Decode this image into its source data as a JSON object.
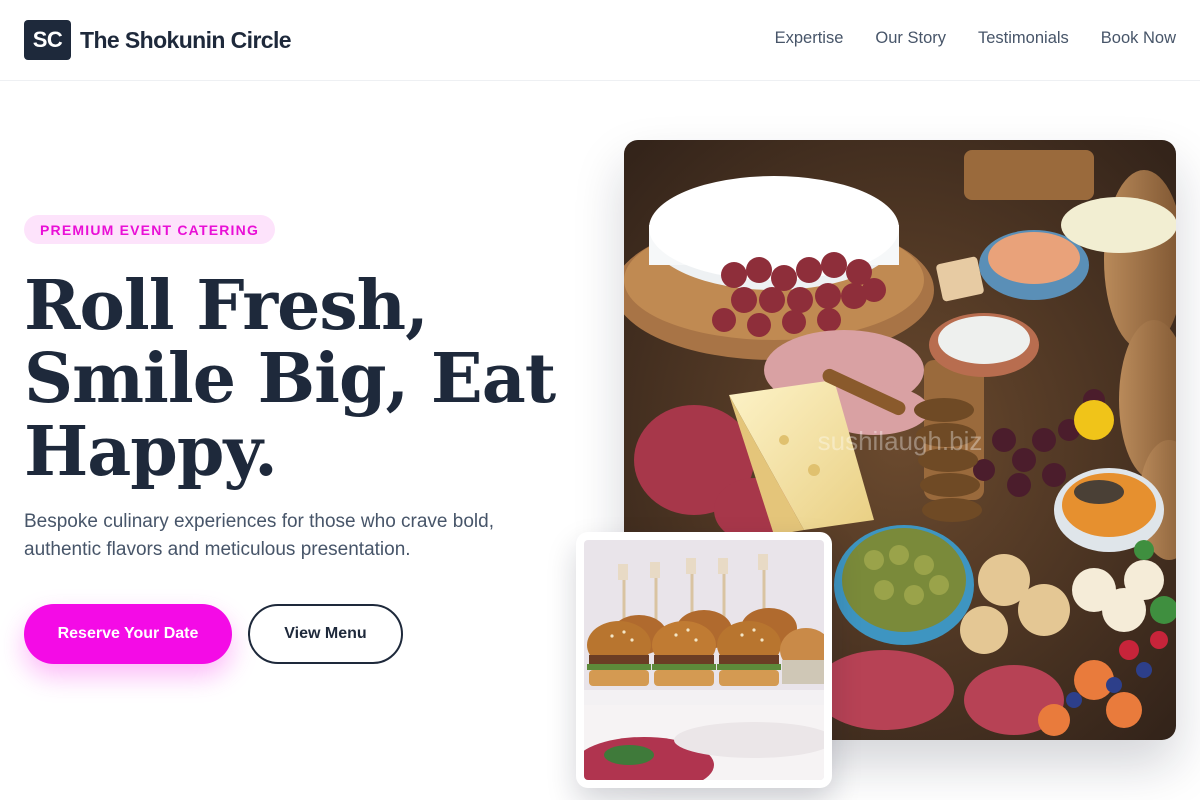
{
  "header": {
    "logo_mark": "SC",
    "brand_name": "The Shokunin Circle",
    "nav": [
      "Expertise",
      "Our Story",
      "Testimonials",
      "Book Now"
    ]
  },
  "hero": {
    "badge": "PREMIUM EVENT CATERING",
    "headline": [
      "Roll Fresh,",
      "Smile Big, Eat",
      "Happy."
    ],
    "subtitle": "Bespoke culinary experiences for those who crave bold, authentic flavors and meticulous presentation.",
    "primary_button": "Reserve Your Date",
    "secondary_button": "View Menu",
    "image_watermark": "sushilaugh.biz"
  },
  "colors": {
    "brand_dark": "#1e293b",
    "accent": "#f40be6",
    "badge_bg": "#fde3fb",
    "body_text": "#475569"
  }
}
